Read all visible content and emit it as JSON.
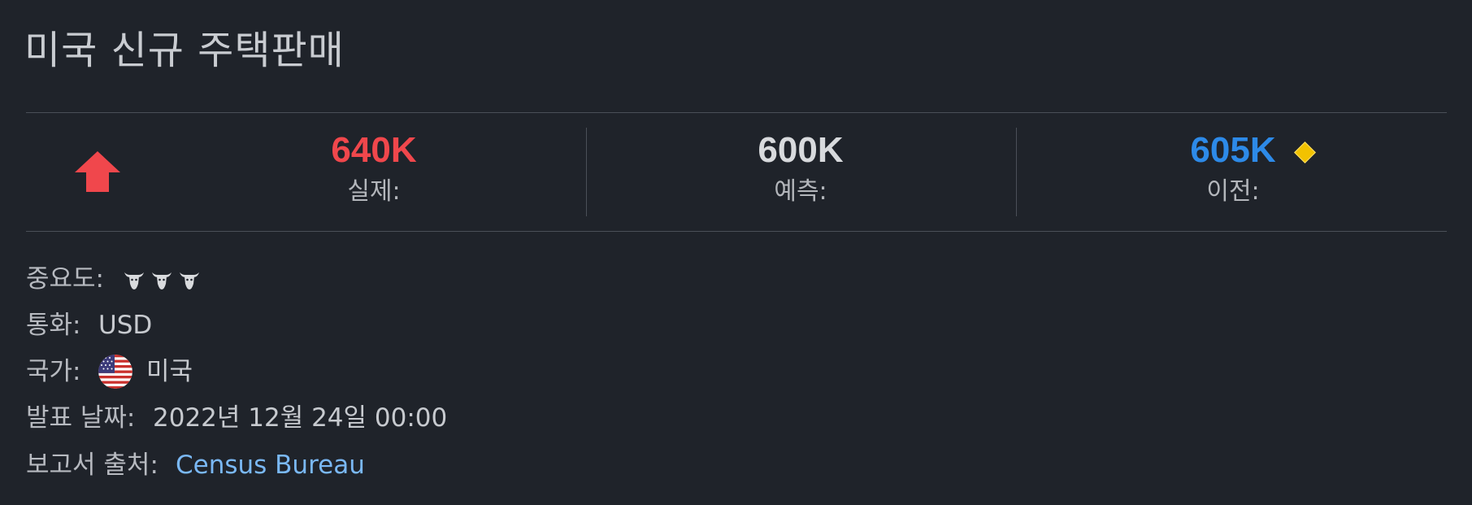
{
  "header": {
    "title": "미국 신규 주택판매"
  },
  "stats": {
    "direction": "up",
    "actual": {
      "value": "640K",
      "label": "실제:",
      "color": "#f0474c"
    },
    "forecast": {
      "value": "600K",
      "label": "예측:",
      "color": "#d8dadd"
    },
    "previous": {
      "value": "605K",
      "label": "이전:",
      "color": "#2d8ae8",
      "revised_icon": "diamond-icon"
    }
  },
  "details": {
    "importance_label": "중요도:",
    "importance_level": 3,
    "importance_icon": "bull-icon",
    "currency_label": "통화:",
    "currency_value": "USD",
    "country_label": "국가:",
    "country_value": "미국",
    "country_flag": "us-flag-icon",
    "date_label": "발표 날짜:",
    "date_value": "2022년 12월 24일 00:00",
    "source_label": "보고서 출처:",
    "source_value": "Census Bureau"
  },
  "colors": {
    "background": "#1f232a",
    "up_arrow": "#f0474c",
    "link": "#7ab8f5",
    "revised_marker": "#f2c200"
  }
}
